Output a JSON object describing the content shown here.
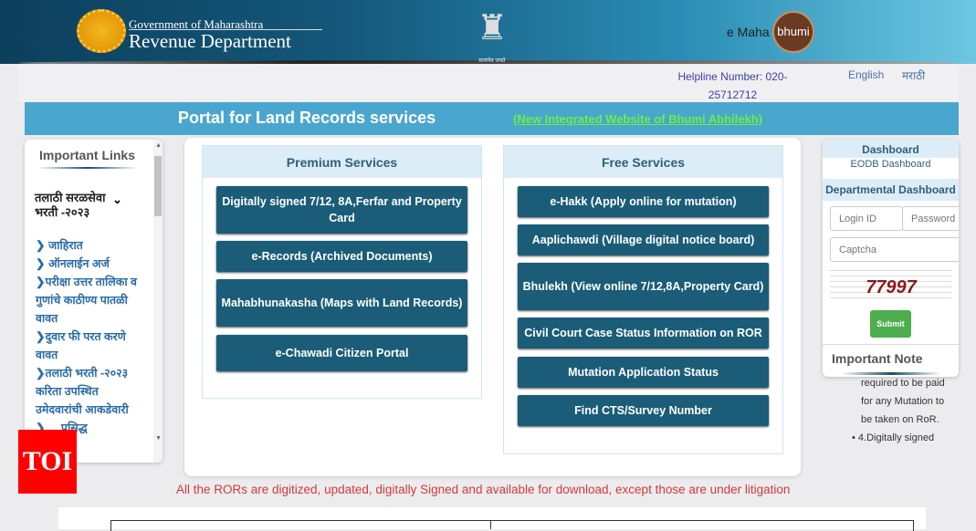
{
  "header": {
    "gov_line1": "Government of Maharashtra",
    "gov_line2": "Revenue Department",
    "emblem_caption": "सत्यमेव जयते",
    "logo_prefix": "e Maha",
    "logo_badge": "bhumi"
  },
  "topbar": {
    "helpline": "Helpline Number: 020-25712712",
    "lang_english": "English",
    "lang_marathi": "मराठी"
  },
  "banner": {
    "title": "Portal for Land Records services",
    "link": "(New Integrated Website of Bhumi Abhilekh)"
  },
  "left_panel": {
    "title": "Important Links",
    "section": "तलाठी सरळसेवा भरती -२०२३",
    "links": [
      "❯ जाहिरात",
      "❯ ऑनलाईन अर्ज",
      "❯परीक्षा उत्तर तालिका व गुणांचे काठीण्य पातळी वावत",
      "❯दुवार फी परत करणे वावत",
      "❯तलाठी भरती -२०२३ करिता उपस्थित उमेदवारांची आकडेवारी",
      "❯ ... प्रसिद्ध"
    ]
  },
  "premium": {
    "title": "Premium Services",
    "buttons": [
      "Digitally signed 7/12, 8A,Ferfar and Property Card",
      "e-Records (Archived Documents)",
      "Mahabhunakasha (Maps with Land Records)",
      "e-Chawadi Citizen Portal"
    ]
  },
  "free": {
    "title": "Free Services",
    "buttons": [
      "e-Hakk (Apply online for mutation)",
      "Aaplichawdi (Village digital notice board)",
      "Bhulekh (View online 7/12,8A,Property Card)",
      "Civil Court Case Status Information on ROR",
      "Mutation Application Status",
      "Find CTS/Survey Number"
    ]
  },
  "right_panel": {
    "dashboard": "Dashboard",
    "eodb": "EODB Dashboard",
    "departmental": "Departmental Dashboard",
    "login_placeholder": "Login ID",
    "password_placeholder": "Password",
    "captcha_placeholder": "Captcha",
    "captcha_value": "77997",
    "submit": "Submit",
    "important_note": "Important Note",
    "note_text": "required to be paid for any Mutation to be taken on RoR.",
    "note_bullet": "4.Digitally signed"
  },
  "footer_note": "All the RORs are digitized, updated, digitally Signed and available for download, except those are under litigation",
  "watermark": "TOI"
}
